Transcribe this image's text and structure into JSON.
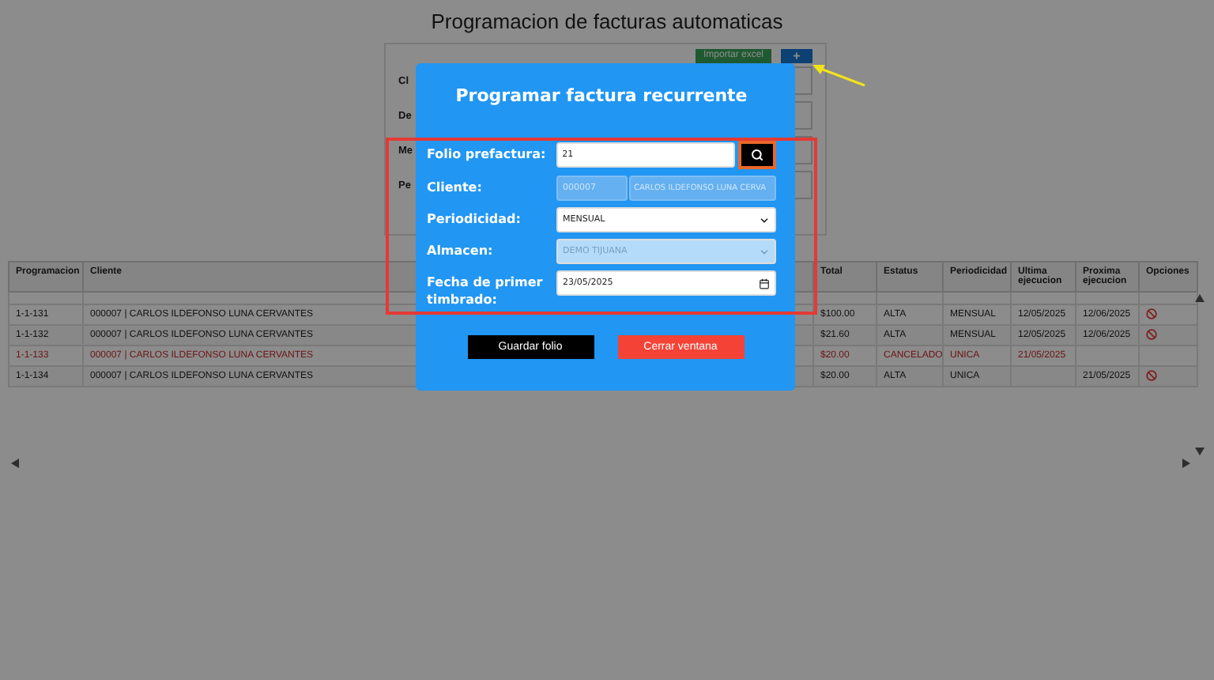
{
  "page_title": "Programacion de facturas automaticas",
  "background_form": {
    "labels": [
      "Cl",
      "De",
      "Me",
      "Pe"
    ],
    "import_button": "Importar excel",
    "add_button": "+"
  },
  "table": {
    "columns": [
      "Programacion",
      "Cliente",
      "Total",
      "Estatus",
      "Periodicidad",
      "Ultima ejecucion",
      "Proxima ejecucion",
      "Opciones"
    ],
    "rows": [
      {
        "cells": [
          "1-1-131",
          "000007 | CARLOS ILDEFONSO LUNA CERVANTES",
          "$100.00",
          "ALTA",
          "MENSUAL",
          "12/05/2025",
          "12/06/2025"
        ],
        "cancelled": false,
        "can_cancel": true
      },
      {
        "cells": [
          "1-1-132",
          "000007 | CARLOS ILDEFONSO LUNA CERVANTES",
          "$21.60",
          "ALTA",
          "MENSUAL",
          "12/05/2025",
          "12/06/2025"
        ],
        "cancelled": false,
        "can_cancel": true
      },
      {
        "cells": [
          "1-1-133",
          "000007 | CARLOS ILDEFONSO LUNA CERVANTES",
          "$20.00",
          "CANCELADO",
          "UNICA",
          "21/05/2025",
          ""
        ],
        "cancelled": true,
        "can_cancel": false
      },
      {
        "cells": [
          "1-1-134",
          "000007 | CARLOS ILDEFONSO LUNA CERVANTES",
          "$20.00",
          "ALTA",
          "UNICA",
          "",
          "21/05/2025"
        ],
        "cancelled": false,
        "can_cancel": true
      }
    ]
  },
  "modal": {
    "title": "Programar factura recurrente",
    "fields": [
      {
        "kind": "search",
        "label": "Folio prefactura:",
        "value": "21",
        "disabled": false
      },
      {
        "kind": "pair",
        "label": "Cliente:",
        "value": "000007",
        "value_2": "CARLOS ILDEFONSO LUNA CERVA",
        "disabled": true
      },
      {
        "kind": "select",
        "label": "Periodicidad:",
        "value": "MENSUAL",
        "disabled": false
      },
      {
        "kind": "select",
        "label": "Almacen:",
        "value": "DEMO TIJUANA",
        "disabled": true
      },
      {
        "kind": "date",
        "label": "Fecha de primer timbrado:",
        "value": "23/05/2025",
        "disabled": false
      }
    ],
    "buttons": [
      {
        "kind": "save",
        "label": "Guardar folio"
      },
      {
        "kind": "close",
        "label": "Cerrar ventana"
      }
    ]
  }
}
